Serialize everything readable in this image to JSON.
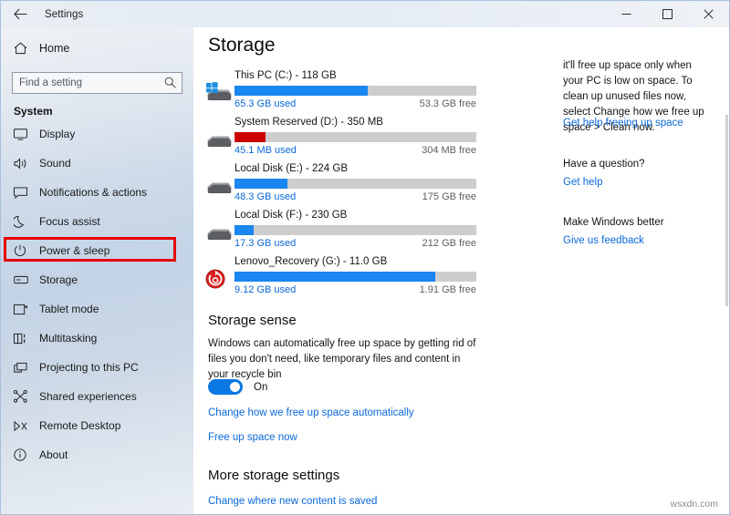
{
  "window": {
    "title": "Settings",
    "back_icon": "back-arrow-icon",
    "minimize_label": "─",
    "maximize_label": "□",
    "close_label": "✕"
  },
  "sidebar": {
    "home_label": "Home",
    "search": {
      "placeholder": "Find a setting",
      "value": "",
      "icon": "search-icon"
    },
    "section_header": "System",
    "items": [
      {
        "label": "Display",
        "icon": "monitor-icon",
        "selected": false
      },
      {
        "label": "Sound",
        "icon": "speaker-icon",
        "selected": false
      },
      {
        "label": "Notifications & actions",
        "icon": "notification-icon",
        "selected": false
      },
      {
        "label": "Focus assist",
        "icon": "moon-icon",
        "selected": false
      },
      {
        "label": "Power & sleep",
        "icon": "power-icon",
        "selected": false
      },
      {
        "label": "Storage",
        "icon": "storage-icon",
        "selected": true
      },
      {
        "label": "Tablet mode",
        "icon": "tablet-icon",
        "selected": false
      },
      {
        "label": "Multitasking",
        "icon": "multitasking-icon",
        "selected": false
      },
      {
        "label": "Projecting to this PC",
        "icon": "projecting-icon",
        "selected": false
      },
      {
        "label": "Shared experiences",
        "icon": "shared-icon",
        "selected": false
      },
      {
        "label": "Remote Desktop",
        "icon": "remote-desktop-icon",
        "selected": false
      },
      {
        "label": "About",
        "icon": "info-icon",
        "selected": false
      }
    ],
    "highlight_color": "#e50000"
  },
  "main": {
    "page_title": "Storage",
    "drives": [
      {
        "name": "This PC (C:) - 118 GB",
        "used": "65.3 GB used",
        "free": "53.3 GB free",
        "percent": 55,
        "bar_color": "#1a86f0",
        "icon": "windows-drive-icon"
      },
      {
        "name": "System Reserved (D:) - 350 MB",
        "used": "45.1 MB used",
        "free": "304 MB free",
        "percent": 13,
        "bar_color": "#cc0000",
        "icon": "drive-icon"
      },
      {
        "name": "Local Disk (E:) - 224 GB",
        "used": "48.3 GB used",
        "free": "175 GB free",
        "percent": 22,
        "bar_color": "#1a86f0",
        "icon": "drive-icon"
      },
      {
        "name": "Local Disk (F:) - 230 GB",
        "used": "17.3 GB used",
        "free": "212 GB free",
        "percent": 8,
        "bar_color": "#1a86f0",
        "icon": "drive-icon"
      },
      {
        "name": "Lenovo_Recovery (G:) - 11.0 GB",
        "used": "9.12 GB used",
        "free": "1.91 GB free",
        "percent": 83,
        "bar_color": "#1a86f0",
        "icon": "recovery-drive-icon"
      }
    ],
    "storage_sense": {
      "title": "Storage sense",
      "description": "Windows can automatically free up space by getting rid of files you don't need, like temporary files and content in your recycle bin",
      "toggle_state": "On",
      "toggle_on": true,
      "link_change_auto": "Change how we free up space automatically",
      "link_free_up": "Free up space now"
    },
    "more_settings": {
      "title": "More storage settings",
      "link_change_content": "Change where new content is saved"
    }
  },
  "right_panel": {
    "paragraph": "it'll free up space only when your PC is low on space. To clean up unused files now, select Change how we free up space > Clean now.",
    "link_help_space": "Get help freeing up space",
    "question_header": "Have a question?",
    "link_get_help": "Get help",
    "better_header": "Make Windows better",
    "link_feedback": "Give us feedback"
  },
  "watermark": "wsxdn.com"
}
